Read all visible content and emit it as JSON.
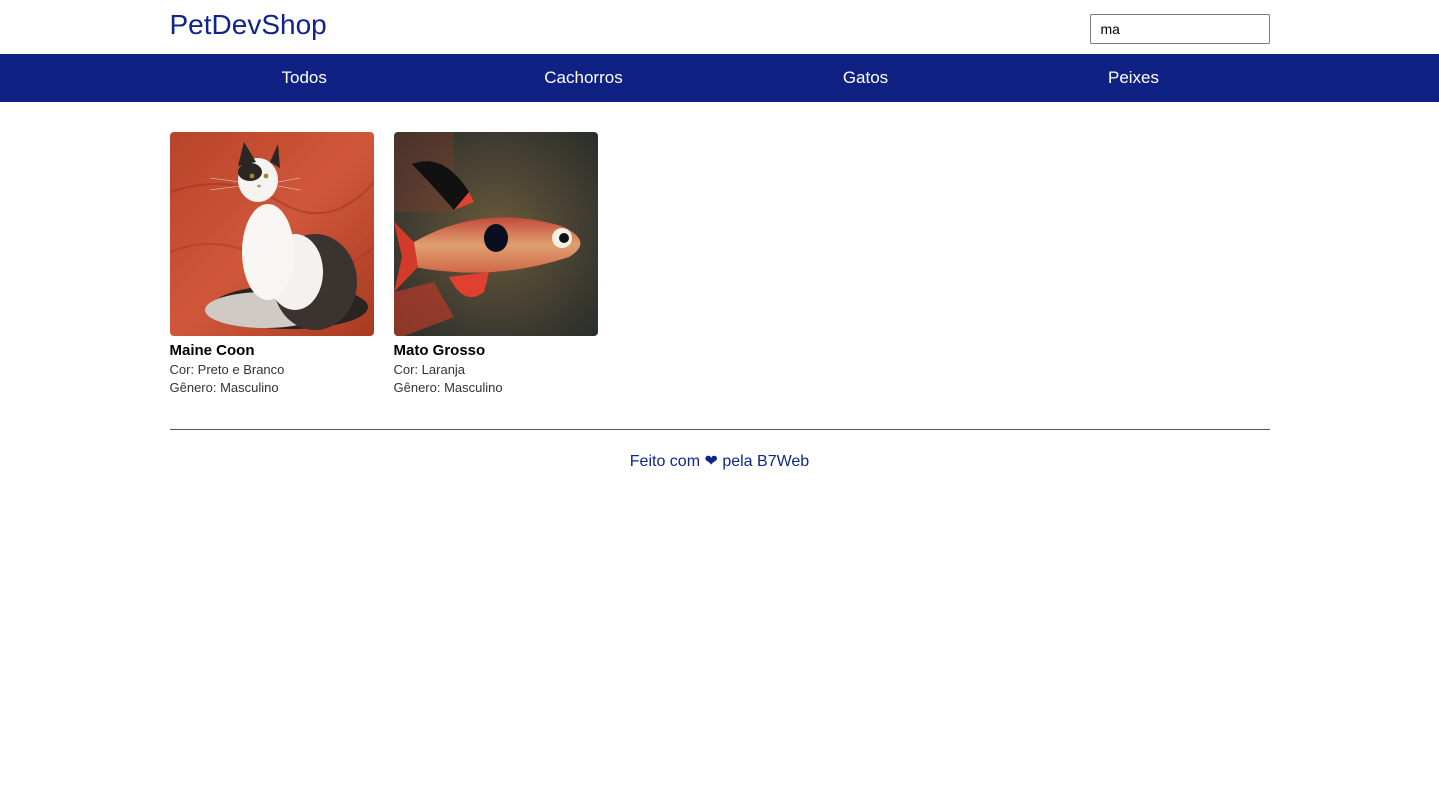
{
  "header": {
    "logo": "PetDevShop",
    "search_value": "ma"
  },
  "nav": {
    "items": [
      {
        "label": "Todos"
      },
      {
        "label": "Cachorros"
      },
      {
        "label": "Gatos"
      },
      {
        "label": "Peixes"
      }
    ]
  },
  "pets": [
    {
      "name": "Maine Coon",
      "color_line": "Cor: Preto e Branco",
      "gender_line": "Gênero: Masculino",
      "image": "cat-photo"
    },
    {
      "name": "Mato Grosso",
      "color_line": "Cor: Laranja",
      "gender_line": "Gênero: Masculino",
      "image": "fish-photo"
    }
  ],
  "footer": {
    "credit": "Feito com ❤ pela B7Web"
  },
  "colors": {
    "brand": "#0f258a",
    "nav_bg": "#0f2284",
    "cat_bg": "#c24a2c",
    "fish_bg": "#4a3a2a"
  }
}
